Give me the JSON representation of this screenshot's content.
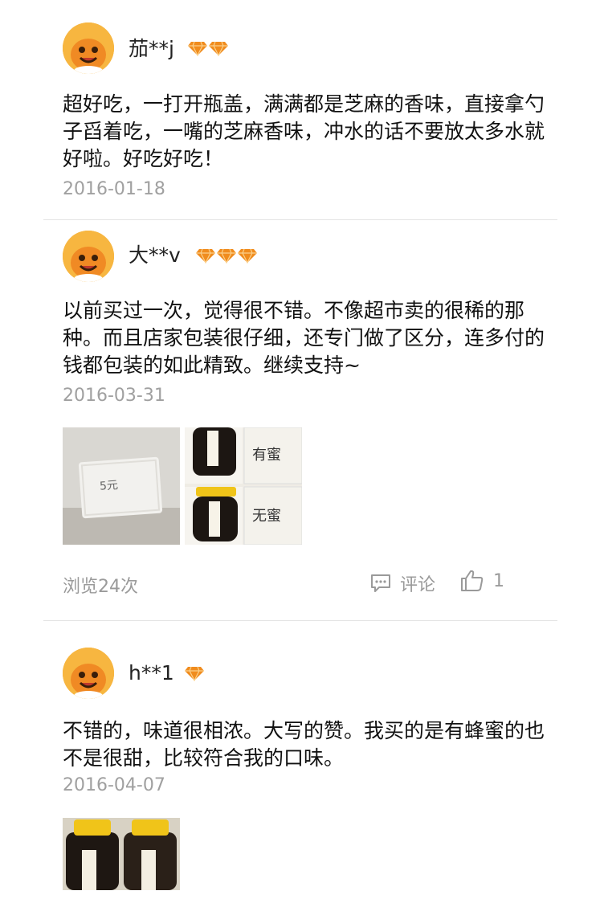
{
  "reviews": [
    {
      "username": "茄**j",
      "badge_count": 2,
      "text": "超好吃，一打开瓶盖，满满都是芝麻的香味，直接拿勺子舀着吃，一嘴的芝麻香味，冲水的话不要放太多水就好啦。好吃好吃！",
      "date": "2016-01-18"
    },
    {
      "username": "大**v",
      "badge_count": 3,
      "text": "以前买过一次，觉得很不错。不像超市卖的很稀的那种。而且店家包装很仔细，还专门做了区分，连多付的钱都包装的如此精致。继续支持~",
      "date": "2016-03-31",
      "photo_labels": [
        "5元",
        "有蜜",
        "无蜜"
      ],
      "views": "浏览24次",
      "comment_label": "评论",
      "like_count": "1"
    },
    {
      "username": "h**1",
      "badge_count": 1,
      "text": "不错的，味道很相浓。大写的赞。我买的是有蜂蜜的也不是很甜，比较符合我的口味。",
      "date": "2016-04-07"
    }
  ],
  "colors": {
    "avatar": "#f5a623",
    "badge": "#f08c1e",
    "meta": "#9a9a9a",
    "divider": "#e4e4e4"
  }
}
